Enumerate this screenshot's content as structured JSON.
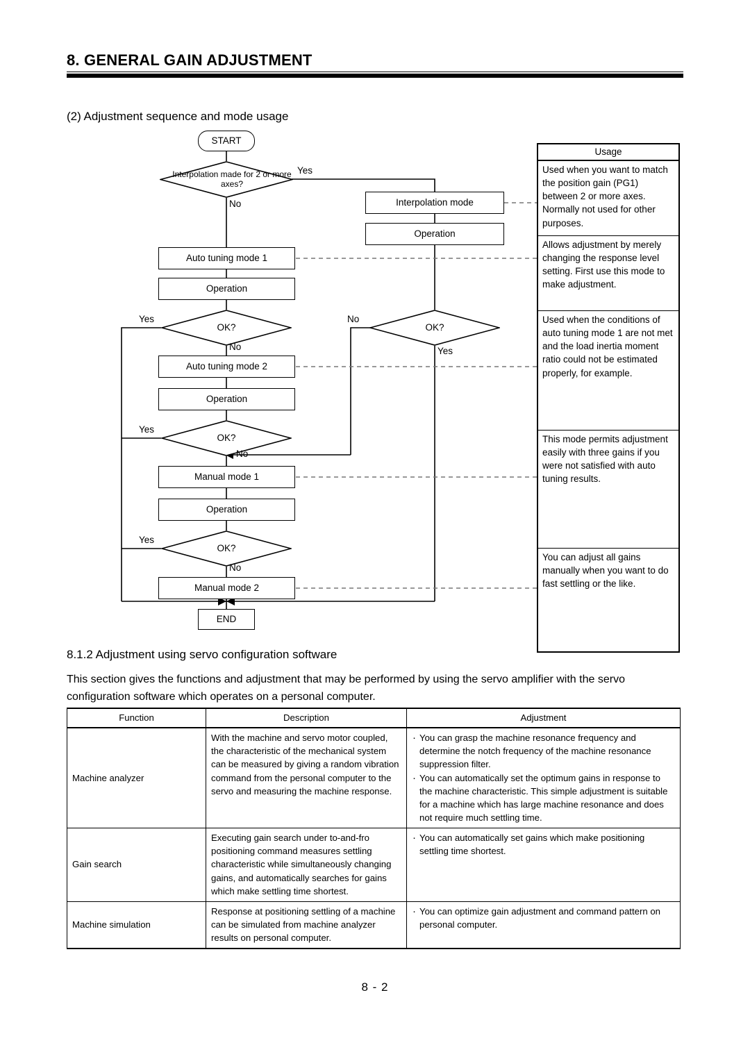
{
  "header": {
    "chapter_title": "8. GENERAL GAIN ADJUSTMENT"
  },
  "section": {
    "item_label": "(2) Adjustment sequence and mode usage",
    "sub_heading": "8.1.2 Adjustment using servo configuration software",
    "intro_paragraph": "This section gives the functions and adjustment that may be performed by using the servo amplifier with the servo configuration software which operates on a personal computer."
  },
  "flowchart": {
    "start": "START",
    "end": "END",
    "decision_interpolation": "Interpolation made for 2 or more axes?",
    "decision_ok": "OK?",
    "interpolation_mode": "Interpolation mode",
    "operation": "Operation",
    "auto_tuning_mode_1": "Auto tuning mode 1",
    "auto_tuning_mode_2": "Auto tuning mode 2",
    "manual_mode_1": "Manual mode 1",
    "manual_mode_2": "Manual mode 2",
    "yes": "Yes",
    "no": "No"
  },
  "usage_table": {
    "header": "Usage",
    "rows": [
      "Used when you want to match the position gain (PG1) between 2 or more axes. Normally not used for other purposes.",
      "Allows adjustment by merely changing the response level setting. First use this mode to make adjustment.",
      "Used when the conditions of auto tuning mode 1 are not met and the load inertia moment ratio could not be estimated properly, for example.",
      "This mode permits adjustment easily with three gains if you were not satisfied with auto tuning results.",
      "You can adjust all gains manually when you want to do fast settling or the like."
    ]
  },
  "function_table": {
    "columns": [
      "Function",
      "Description",
      "Adjustment"
    ],
    "rows": [
      {
        "function": "Machine analyzer",
        "description": "With the machine and servo motor coupled, the characteristic of the mechanical system can be measured by giving a random vibration command from the personal computer to the servo and measuring the machine response.",
        "adjustment": [
          "You can grasp the machine resonance frequency and determine the notch frequency of the machine resonance suppression filter.",
          "You can automatically set the optimum gains in response to the machine characteristic. This simple adjustment is suitable for a machine which has large machine resonance and does not require much settling time."
        ]
      },
      {
        "function": "Gain search",
        "description": "Executing gain search under to-and-fro positioning command measures settling characteristic while simultaneously changing gains, and automatically searches for gains which make settling time shortest.",
        "adjustment": [
          "You can automatically set gains which make positioning settling time shortest."
        ]
      },
      {
        "function": "Machine simulation",
        "description": "Response at positioning settling of a machine can be simulated from machine analyzer results on personal computer.",
        "adjustment": [
          "You can optimize gain adjustment and command pattern on personal computer."
        ]
      }
    ]
  },
  "footer": {
    "page_number": "8 - 2"
  }
}
